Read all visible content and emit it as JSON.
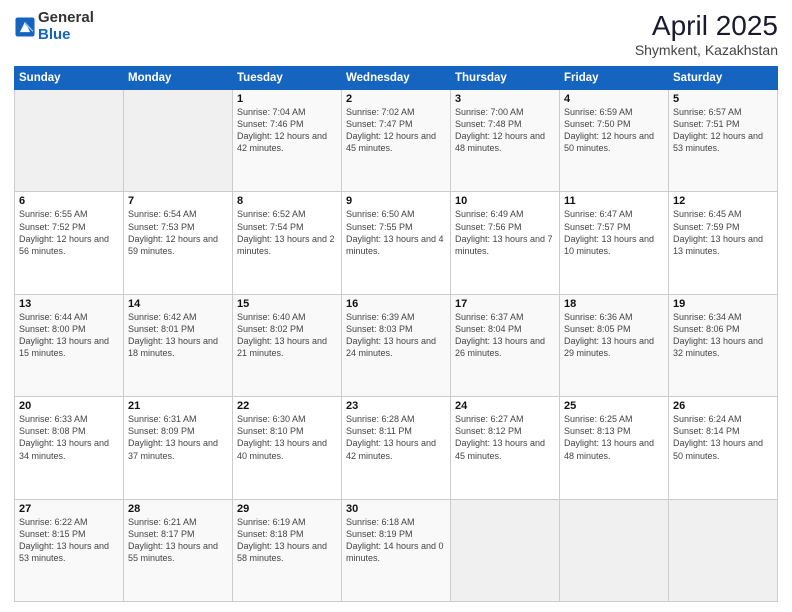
{
  "header": {
    "logo_line1": "General",
    "logo_line2": "Blue",
    "month_year": "April 2025",
    "location": "Shymkent, Kazakhstan"
  },
  "weekdays": [
    "Sunday",
    "Monday",
    "Tuesday",
    "Wednesday",
    "Thursday",
    "Friday",
    "Saturday"
  ],
  "weeks": [
    [
      {
        "day": "",
        "sunrise": "",
        "sunset": "",
        "daylight": "",
        "empty": true
      },
      {
        "day": "",
        "sunrise": "",
        "sunset": "",
        "daylight": "",
        "empty": true
      },
      {
        "day": "1",
        "sunrise": "Sunrise: 7:04 AM",
        "sunset": "Sunset: 7:46 PM",
        "daylight": "Daylight: 12 hours and 42 minutes."
      },
      {
        "day": "2",
        "sunrise": "Sunrise: 7:02 AM",
        "sunset": "Sunset: 7:47 PM",
        "daylight": "Daylight: 12 hours and 45 minutes."
      },
      {
        "day": "3",
        "sunrise": "Sunrise: 7:00 AM",
        "sunset": "Sunset: 7:48 PM",
        "daylight": "Daylight: 12 hours and 48 minutes."
      },
      {
        "day": "4",
        "sunrise": "Sunrise: 6:59 AM",
        "sunset": "Sunset: 7:50 PM",
        "daylight": "Daylight: 12 hours and 50 minutes."
      },
      {
        "day": "5",
        "sunrise": "Sunrise: 6:57 AM",
        "sunset": "Sunset: 7:51 PM",
        "daylight": "Daylight: 12 hours and 53 minutes."
      }
    ],
    [
      {
        "day": "6",
        "sunrise": "Sunrise: 6:55 AM",
        "sunset": "Sunset: 7:52 PM",
        "daylight": "Daylight: 12 hours and 56 minutes."
      },
      {
        "day": "7",
        "sunrise": "Sunrise: 6:54 AM",
        "sunset": "Sunset: 7:53 PM",
        "daylight": "Daylight: 12 hours and 59 minutes."
      },
      {
        "day": "8",
        "sunrise": "Sunrise: 6:52 AM",
        "sunset": "Sunset: 7:54 PM",
        "daylight": "Daylight: 13 hours and 2 minutes."
      },
      {
        "day": "9",
        "sunrise": "Sunrise: 6:50 AM",
        "sunset": "Sunset: 7:55 PM",
        "daylight": "Daylight: 13 hours and 4 minutes."
      },
      {
        "day": "10",
        "sunrise": "Sunrise: 6:49 AM",
        "sunset": "Sunset: 7:56 PM",
        "daylight": "Daylight: 13 hours and 7 minutes."
      },
      {
        "day": "11",
        "sunrise": "Sunrise: 6:47 AM",
        "sunset": "Sunset: 7:57 PM",
        "daylight": "Daylight: 13 hours and 10 minutes."
      },
      {
        "day": "12",
        "sunrise": "Sunrise: 6:45 AM",
        "sunset": "Sunset: 7:59 PM",
        "daylight": "Daylight: 13 hours and 13 minutes."
      }
    ],
    [
      {
        "day": "13",
        "sunrise": "Sunrise: 6:44 AM",
        "sunset": "Sunset: 8:00 PM",
        "daylight": "Daylight: 13 hours and 15 minutes."
      },
      {
        "day": "14",
        "sunrise": "Sunrise: 6:42 AM",
        "sunset": "Sunset: 8:01 PM",
        "daylight": "Daylight: 13 hours and 18 minutes."
      },
      {
        "day": "15",
        "sunrise": "Sunrise: 6:40 AM",
        "sunset": "Sunset: 8:02 PM",
        "daylight": "Daylight: 13 hours and 21 minutes."
      },
      {
        "day": "16",
        "sunrise": "Sunrise: 6:39 AM",
        "sunset": "Sunset: 8:03 PM",
        "daylight": "Daylight: 13 hours and 24 minutes."
      },
      {
        "day": "17",
        "sunrise": "Sunrise: 6:37 AM",
        "sunset": "Sunset: 8:04 PM",
        "daylight": "Daylight: 13 hours and 26 minutes."
      },
      {
        "day": "18",
        "sunrise": "Sunrise: 6:36 AM",
        "sunset": "Sunset: 8:05 PM",
        "daylight": "Daylight: 13 hours and 29 minutes."
      },
      {
        "day": "19",
        "sunrise": "Sunrise: 6:34 AM",
        "sunset": "Sunset: 8:06 PM",
        "daylight": "Daylight: 13 hours and 32 minutes."
      }
    ],
    [
      {
        "day": "20",
        "sunrise": "Sunrise: 6:33 AM",
        "sunset": "Sunset: 8:08 PM",
        "daylight": "Daylight: 13 hours and 34 minutes."
      },
      {
        "day": "21",
        "sunrise": "Sunrise: 6:31 AM",
        "sunset": "Sunset: 8:09 PM",
        "daylight": "Daylight: 13 hours and 37 minutes."
      },
      {
        "day": "22",
        "sunrise": "Sunrise: 6:30 AM",
        "sunset": "Sunset: 8:10 PM",
        "daylight": "Daylight: 13 hours and 40 minutes."
      },
      {
        "day": "23",
        "sunrise": "Sunrise: 6:28 AM",
        "sunset": "Sunset: 8:11 PM",
        "daylight": "Daylight: 13 hours and 42 minutes."
      },
      {
        "day": "24",
        "sunrise": "Sunrise: 6:27 AM",
        "sunset": "Sunset: 8:12 PM",
        "daylight": "Daylight: 13 hours and 45 minutes."
      },
      {
        "day": "25",
        "sunrise": "Sunrise: 6:25 AM",
        "sunset": "Sunset: 8:13 PM",
        "daylight": "Daylight: 13 hours and 48 minutes."
      },
      {
        "day": "26",
        "sunrise": "Sunrise: 6:24 AM",
        "sunset": "Sunset: 8:14 PM",
        "daylight": "Daylight: 13 hours and 50 minutes."
      }
    ],
    [
      {
        "day": "27",
        "sunrise": "Sunrise: 6:22 AM",
        "sunset": "Sunset: 8:15 PM",
        "daylight": "Daylight: 13 hours and 53 minutes."
      },
      {
        "day": "28",
        "sunrise": "Sunrise: 6:21 AM",
        "sunset": "Sunset: 8:17 PM",
        "daylight": "Daylight: 13 hours and 55 minutes."
      },
      {
        "day": "29",
        "sunrise": "Sunrise: 6:19 AM",
        "sunset": "Sunset: 8:18 PM",
        "daylight": "Daylight: 13 hours and 58 minutes."
      },
      {
        "day": "30",
        "sunrise": "Sunrise: 6:18 AM",
        "sunset": "Sunset: 8:19 PM",
        "daylight": "Daylight: 14 hours and 0 minutes."
      },
      {
        "day": "",
        "sunrise": "",
        "sunset": "",
        "daylight": "",
        "empty": true
      },
      {
        "day": "",
        "sunrise": "",
        "sunset": "",
        "daylight": "",
        "empty": true
      },
      {
        "day": "",
        "sunrise": "",
        "sunset": "",
        "daylight": "",
        "empty": true
      }
    ]
  ]
}
